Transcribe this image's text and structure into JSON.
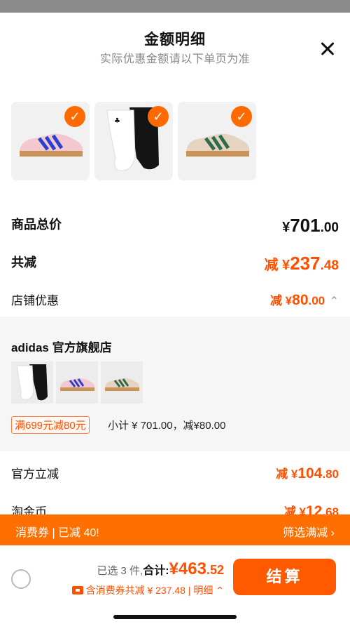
{
  "header": {
    "title": "金额明细",
    "subtitle": "实际优惠金额请以下单页为准"
  },
  "summary": {
    "goods_total_label": "商品总价",
    "goods_total_currency": "¥",
    "goods_total_int": "701",
    "goods_total_dec": ".00",
    "total_reduce_label": "共减",
    "total_reduce_prefix": "减 ¥",
    "total_reduce_int": "237",
    "total_reduce_dec": ".48",
    "store_discount_label": "店铺优惠",
    "store_discount_prefix": "减 ¥",
    "store_discount_int": "80",
    "store_discount_dec": ".00",
    "store_discount_chevron": "⌃"
  },
  "store": {
    "name": "adidas 官方旗舰店",
    "promo_tag": "满699元减80元",
    "promo_text": "小计 ¥ 701.00，减¥80.00"
  },
  "extra": {
    "official_label": "官方立减",
    "official_prefix": "减 ¥",
    "official_int": "104",
    "official_dec": ".80",
    "coin_label": "淘金币",
    "coin_prefix": "减 ¥",
    "coin_int": "12",
    "coin_dec": ".68"
  },
  "banner": {
    "left": "消费券 | 已减 40!",
    "right": "筛选满减 ›"
  },
  "footer": {
    "selected": "已选 3 件,",
    "total_label": "合计:",
    "currency": "¥",
    "amount_int": "463",
    "amount_dec": ".52",
    "detail": "含消费券共减 ¥ 237.48 | 明细 ⌃",
    "checkout": "结算"
  },
  "colors": {
    "accent": "#ff5000",
    "banner": "#ff6f00"
  }
}
